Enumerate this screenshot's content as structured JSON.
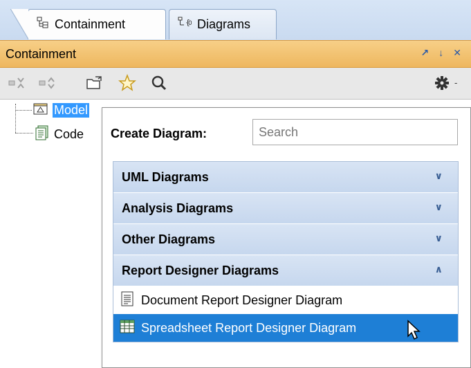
{
  "tabs": [
    {
      "label": "Containment",
      "icon": "containment-tree-icon",
      "active": true
    },
    {
      "label": "Diagrams",
      "icon": "diagrams-icon",
      "active": false
    }
  ],
  "panel": {
    "title": "Containment",
    "buttons": [
      "pin-icon",
      "autohide-icon",
      "close-icon"
    ]
  },
  "toolbar": {
    "icons": [
      "collapse-all-icon",
      "expand-all-icon",
      "open-folder-icon",
      "favorite-star-icon",
      "search-icon",
      "settings-gear-icon"
    ]
  },
  "tree": {
    "items": [
      {
        "label": "Model",
        "icon": "package-icon",
        "selected": true
      },
      {
        "label": "Code",
        "icon": "code-icon",
        "selected": false
      }
    ]
  },
  "popup": {
    "create_label": "Create Diagram:",
    "search_placeholder": "Search",
    "categories": [
      {
        "label": "UML Diagrams",
        "expanded": false
      },
      {
        "label": "Analysis Diagrams",
        "expanded": false
      },
      {
        "label": "Other Diagrams",
        "expanded": false
      },
      {
        "label": "Report Designer Diagrams",
        "expanded": true
      }
    ],
    "report_items": [
      {
        "label": "Document Report Designer Diagram",
        "icon": "document-icon",
        "selected": false
      },
      {
        "label": "Spreadsheet Report Designer Diagram",
        "icon": "spreadsheet-icon",
        "selected": true
      }
    ]
  },
  "colors": {
    "title_bar": "#f2c06c",
    "selection": "#1e7fd6",
    "category_bg": "#d0def1"
  }
}
